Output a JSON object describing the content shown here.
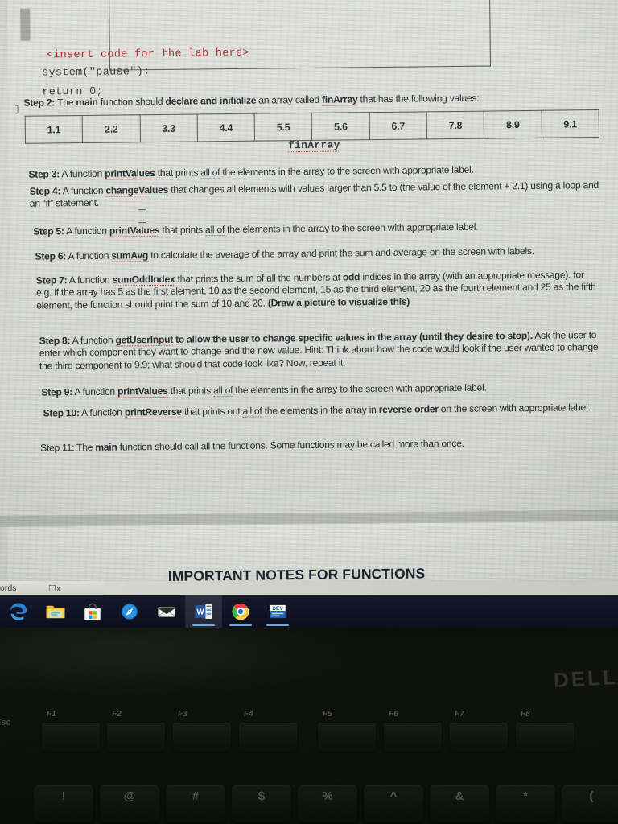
{
  "document": {
    "code_box": {
      "line1": "<insert code for the lab here>",
      "line2": "system(\"pause\");",
      "line3": "return 0;",
      "line4": "}"
    },
    "step2": {
      "prefix": "Step 2:",
      "text_a": "The ",
      "bold_main": "main",
      "text_b": " function should ",
      "bold_declare": "declare and initialize",
      "text_c": " an array called ",
      "bold_finarray": "finArray",
      "text_d": " that has the following values:"
    },
    "array_table": {
      "label": "finArray",
      "values": [
        "1.1",
        "2.2",
        "3.3",
        "4.4",
        "5.5",
        "5.6",
        "6.7",
        "7.8",
        "8.9",
        "9.1"
      ]
    },
    "step3": {
      "prefix": "Step 3:",
      "text_a": " A function ",
      "fn": "printValues",
      "text_b": " that prints ",
      "underlined": "all of",
      "text_c": " the elements in the array to the screen with appropriate label."
    },
    "step4": {
      "prefix": "Step 4:",
      "text_a": " A function ",
      "fn": "changeValues",
      "text_b": " that changes all elements with values larger than 5.5 to (the value of the element + 2.1) using a loop and an “if” statement."
    },
    "step5": {
      "prefix": "Step 5:",
      "text_a": " A function ",
      "fn": "printValues",
      "text_b": " that prints ",
      "underlined": "all of",
      "text_c": " the elements in the array to the screen with appropriate label."
    },
    "step6": {
      "prefix": "Step 6:",
      "text_a": " A function ",
      "fn": "sumAvg",
      "text_b": " to calculate the average of the array and print the sum and average on the screen with labels."
    },
    "step7": {
      "prefix": "Step 7:",
      "text_a": " A function ",
      "fn": "sumOddIndex",
      "text_b": " that prints the sum of all the numbers at ",
      "bold_odd": "odd",
      "text_c": " indices in the array (with an appropriate message). for e.g. if the array has 5 as the first element, 10 as the second element, 15 as the third element, 20 as the fourth element and 25 as the fifth element, the function should print the sum of 10 and 20. ",
      "bold_draw": "(Draw a picture to visualize this)"
    },
    "step8": {
      "prefix": "Step 8:",
      "text_a": " A function ",
      "fn": "getUserInput",
      "bold_b": " to allow the user to change specific values in the array (until they desire to stop).",
      "text_c": "  Ask the user to enter which component they want to change and the new value.  Hint: Think about how the code would look if the user wanted to change the third component to 9.9; what should that code look like? Now, repeat it."
    },
    "step9": {
      "prefix": "Step 9:",
      "text_a": " A function ",
      "fn": "printValues",
      "text_b": " that prints ",
      "underlined": "all of",
      "text_c": " the elements in the array to the screen with appropriate label."
    },
    "step10": {
      "prefix": "Step 10:",
      "text_a": " A function ",
      "fn": "printReverse",
      "text_b": " that prints out ",
      "underlined": "all of",
      "text_c": " the elements in the array in ",
      "bold_rev": "reverse order",
      "text_d": " on the screen with appropriate label."
    },
    "step11": {
      "prefix": "Step 11:",
      "text_a": " The ",
      "bold_main": "main",
      "text_b": " function should call all the functions. Some functions may be called more than once."
    },
    "page2_heading": "IMPORTANT NOTES FOR FUNCTIONS"
  },
  "status_bar": {
    "word_count": "ords",
    "language_icon": "accessibility-icon"
  },
  "taskbar": {
    "items": [
      {
        "name": "edge",
        "icon": "edge-icon",
        "label": "Microsoft Edge",
        "active": false,
        "running": false
      },
      {
        "name": "file-explorer",
        "icon": "folder-icon",
        "label": "File Explorer",
        "active": false,
        "running": false
      },
      {
        "name": "microsoft-store",
        "icon": "store-icon",
        "label": "Microsoft Store",
        "active": false,
        "running": false
      },
      {
        "name": "compass",
        "icon": "compass-icon",
        "label": "Compass",
        "active": false,
        "running": false
      },
      {
        "name": "mail",
        "icon": "mail-icon",
        "label": "Mail",
        "active": false,
        "running": false
      },
      {
        "name": "word",
        "icon": "word-icon",
        "label": "Microsoft Word",
        "active": true,
        "running": true
      },
      {
        "name": "chrome",
        "icon": "chrome-icon",
        "label": "Google Chrome",
        "active": false,
        "running": true
      },
      {
        "name": "dev-app",
        "icon": "dev-app-icon",
        "label": "DEV",
        "active": false,
        "running": true
      }
    ]
  },
  "laptop": {
    "brand": "DELL",
    "esc_key": "Esc",
    "function_keys": [
      "F1",
      "F2",
      "F3",
      "F4",
      "F5",
      "F6",
      "F7",
      "F8"
    ],
    "number_row_symbols": [
      "!",
      "@",
      "#",
      "$",
      "%",
      "^",
      "&",
      "*",
      "("
    ]
  },
  "colors": {
    "code_red": "#b5322e",
    "spellcheck_red": "#c0392b",
    "taskbar_bg": "#0f1324",
    "page_bg": "#dfe0da",
    "bezel_black": "#0b0e0b"
  }
}
